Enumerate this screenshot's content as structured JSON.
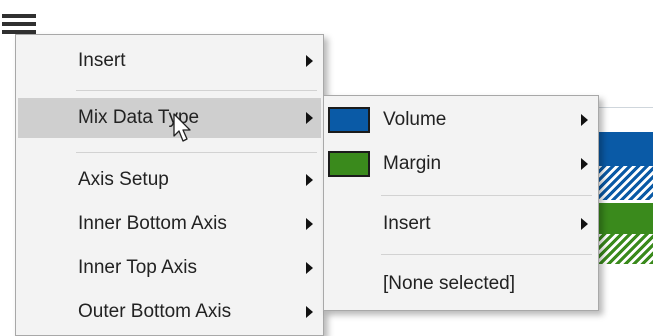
{
  "main_menu": {
    "items": [
      {
        "label": "Insert",
        "has_submenu": true
      },
      {
        "label": "Mix Data Type",
        "has_submenu": true,
        "highlighted": true
      },
      {
        "label": "Axis Setup",
        "has_submenu": true
      },
      {
        "label": "Inner Bottom Axis",
        "has_submenu": true
      },
      {
        "label": "Inner Top Axis",
        "has_submenu": true
      },
      {
        "label": "Outer Bottom Axis",
        "has_submenu": true
      }
    ]
  },
  "sub_menu": {
    "items": [
      {
        "label": "Volume",
        "swatch_color": "#0a5aa6",
        "has_submenu": true
      },
      {
        "label": "Margin",
        "swatch_color": "#3a8a1c",
        "has_submenu": true
      },
      {
        "label": "Insert",
        "has_submenu": true
      },
      {
        "label": "[None selected]",
        "has_submenu": false
      }
    ]
  },
  "colors": {
    "series_volume": "#0a5aa6",
    "series_margin": "#3a8a1c",
    "menu_bg": "#f3f3f3",
    "highlight": "#cfcfcf"
  },
  "icons": {
    "menu": "hamburger-icon",
    "submenu_indicator": "chevron-right-icon",
    "pointer": "mouse-cursor-icon"
  }
}
